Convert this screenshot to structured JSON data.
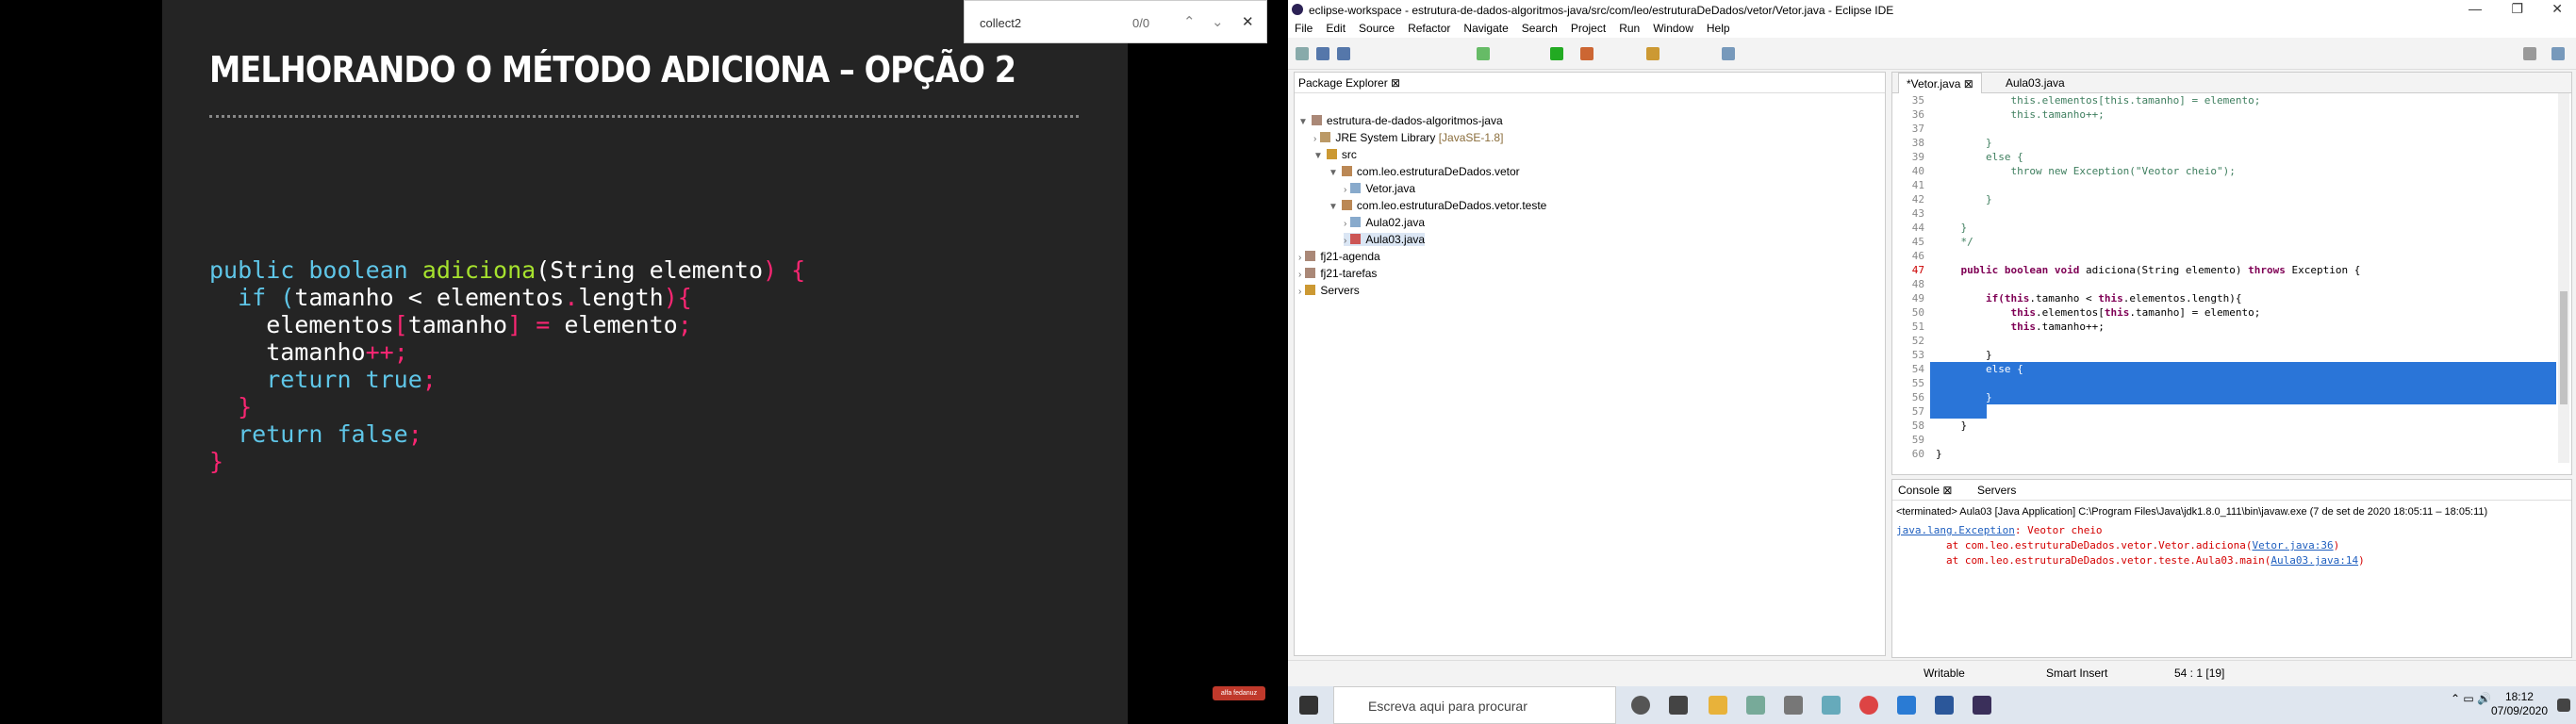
{
  "slide": {
    "title": "MELHORANDO O MÉTODO ADICIONA – OPÇÃO 2",
    "logo": "alfa fedanuz",
    "code": {
      "l1a": "public boolean ",
      "l1b": "adiciona",
      "l1c": "(",
      "l1d": "String ",
      "l1e": "elemento",
      "l1f": ") {",
      "l2a": "  if (",
      "l2b": "tamanho ",
      "l2c": "< ",
      "l2d": "elementos",
      "l2e": ".",
      "l2f": "length",
      "l2g": "){",
      "l3a": "    elementos",
      "l3b": "[",
      "l3c": "tamanho",
      "l3d": "] ",
      "l3e": "= ",
      "l3f": "elemento",
      "l3g": ";",
      "l4a": "    tamanho",
      "l4b": "++",
      "l4c": ";",
      "l5a": "    return ",
      "l5b": "true",
      "l5c": ";",
      "l6": "  }",
      "l7a": "  return ",
      "l7b": "false",
      "l7c": ";",
      "l8": "}"
    }
  },
  "findbar": {
    "query": "collect2",
    "count": "0/0",
    "up": "⌃",
    "down": "⌄",
    "close": "✕"
  },
  "window": {
    "title": "eclipse-workspace - estrutura-de-dados-algoritmos-java/src/com/leo/estruturaDeDados/vetor/Vetor.java - Eclipse IDE",
    "min": "—",
    "max": "❐",
    "close": "✕"
  },
  "menu": [
    "File",
    "Edit",
    "Source",
    "Refactor",
    "Navigate",
    "Search",
    "Project",
    "Run",
    "Window",
    "Help"
  ],
  "explorer": {
    "tab": "Package Explorer ⊠",
    "items": [
      "estrutura-de-dados-algoritmos-java",
      "JRE System Library",
      "[JavaSE-1.8]",
      "src",
      "com.leo.estruturaDeDados.vetor",
      "Vetor.java",
      "com.leo.estruturaDeDados.vetor.teste",
      "Aula02.java",
      "Aula03.java",
      "fj21-agenda",
      "fj21-tarefas",
      "Servers"
    ]
  },
  "editor": {
    "tabs": [
      "*Vetor.java ⊠",
      "Aula03.java"
    ],
    "numbers": [
      "35",
      "36",
      "37",
      "38",
      "39",
      "40",
      "41",
      "42",
      "43",
      "44",
      "45",
      "46",
      "47",
      "48",
      "49",
      "50",
      "51",
      "52",
      "53",
      "54",
      "55",
      "56",
      "57",
      "58",
      "59",
      "60"
    ],
    "l35": "            this.elementos[this.tamanho] = elemento;",
    "l36": "            this.tamanho++;",
    "l37": "",
    "l38": "        }",
    "l39": "        else {",
    "l40a": "            throw new Exception(",
    "l40b": "\"Veotor cheio\"",
    "l40c": ");",
    "l41": "",
    "l42": "        }",
    "l43": "",
    "l44": "    }",
    "l45": "    */",
    "l46": "",
    "l47a": "    public boolean void ",
    "l47b": "adiciona(String elemento) ",
    "l47c": "throws ",
    "l47d": "Exception {",
    "l48": "",
    "l49a": "        if(",
    "l49b": "this",
    "l49c": ".tamanho < ",
    "l49d": "this",
    "l49e": ".elementos.length){",
    "l50a": "            ",
    "l50b": "this",
    "l50c": ".elementos[",
    "l50d": "this",
    "l50e": ".tamanho] = elemento;",
    "l51a": "            ",
    "l51b": "this",
    "l51c": ".tamanho++;",
    "l52": "",
    "l53": "        }",
    "l54": "        else {",
    "l55": "",
    "l56": "        }",
    "l57": "",
    "l58": "    }",
    "l59": "",
    "l60": "}"
  },
  "console": {
    "tab1": "Console ⊠",
    "tab2": "Servers",
    "info": "<terminated> Aula03 [Java Application] C:\\Program Files\\Java\\jdk1.8.0_111\\bin\\javaw.exe  (7 de set de 2020 18:05:11 – 18:05:11)",
    "e1a": "java.lang.Exception",
    "e1b": ": Veotor cheio",
    "e2a": "        at com.leo.estruturaDeDados.vetor.Vetor.adiciona(",
    "e2b": "Vetor.java:36",
    "e2c": ")",
    "e3a": "        at com.leo.estruturaDeDados.vetor.teste.Aula03.main(",
    "e3b": "Aula03.java:14",
    "e3c": ")"
  },
  "status": {
    "mode": "Writable",
    "insert": "Smart Insert",
    "pos": "54 : 1 [19]"
  },
  "taskbar": {
    "search": "Escreva aqui para procurar",
    "time": "18:12",
    "date": "07/09/2020"
  }
}
